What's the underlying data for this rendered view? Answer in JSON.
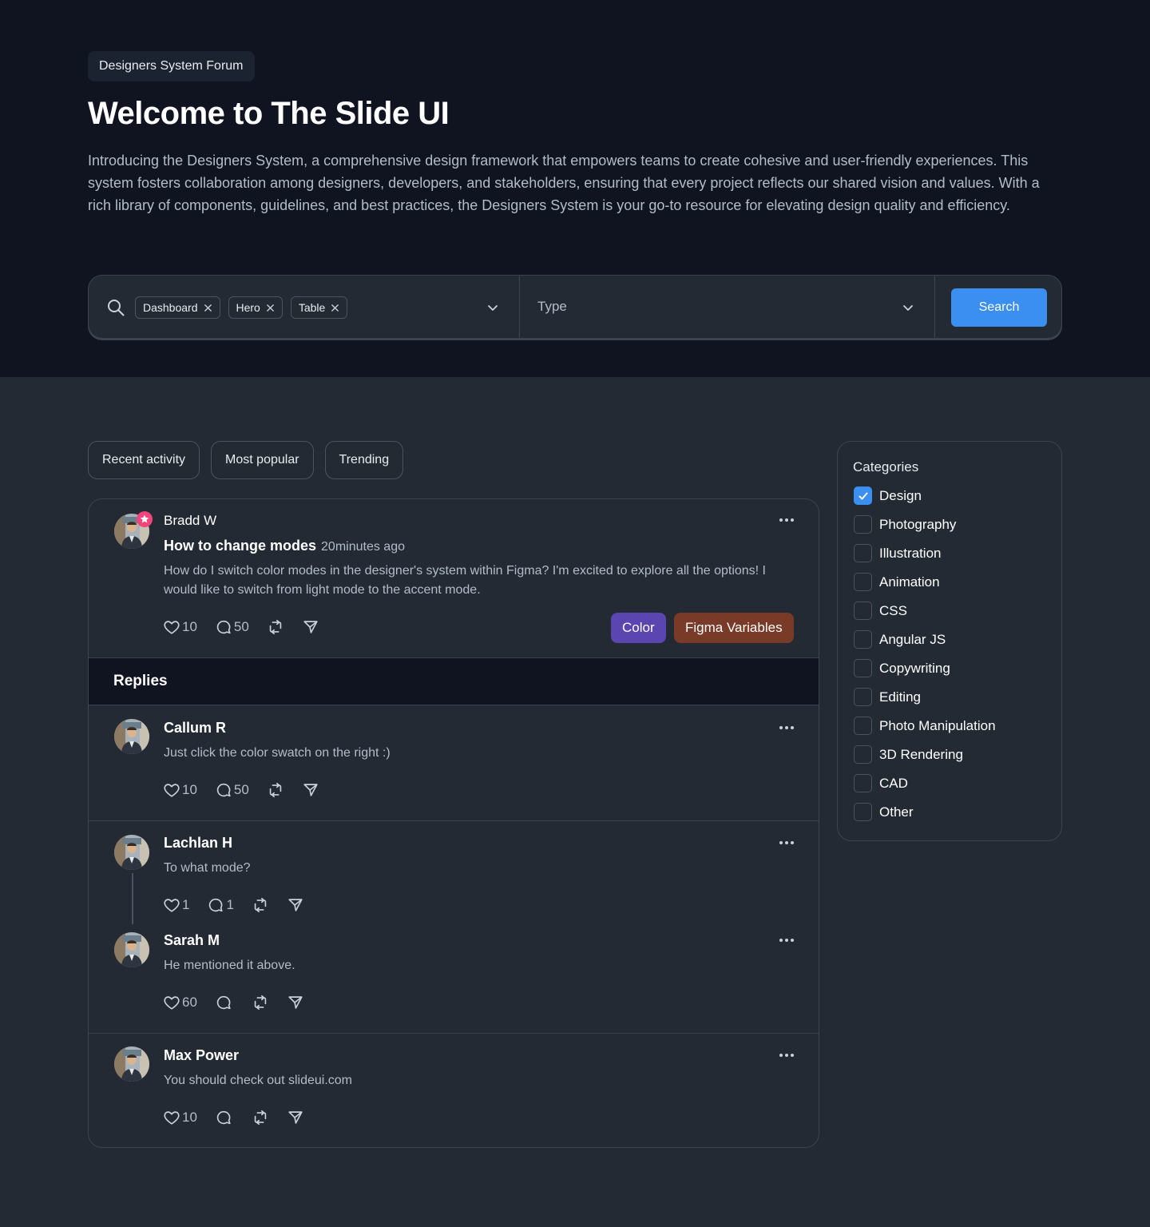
{
  "hero": {
    "badge": "Designers System Forum",
    "title": "Welcome to The Slide UI",
    "description": "Introducing the Designers System, a comprehensive design framework that empowers teams to create cohesive and user-friendly experiences. This system fosters collaboration among designers, developers, and stakeholders, ensuring that every project reflects our shared vision and values. With a rich library of components, guidelines, and best practices, the Designers System is your go-to resource for elevating design quality and efficiency."
  },
  "search": {
    "chips": [
      "Dashboard",
      "Hero",
      "Table"
    ],
    "type_placeholder": "Type",
    "button_label": "Search"
  },
  "tabs": [
    "Recent activity",
    "Most popular",
    "Trending"
  ],
  "post": {
    "author": "Bradd W",
    "title": "How to change modes",
    "time": "20minutes ago",
    "body": "How do I switch color modes in the designer's system within Figma? I'm excited to explore all the options! I would like to switch from light mode to the accent mode.",
    "likes": "10",
    "comments": "50",
    "tags": [
      {
        "label": "Color",
        "color": "#5b45b0"
      },
      {
        "label": "Figma Variables",
        "color": "#7a3a28"
      }
    ]
  },
  "replies_title": "Replies",
  "replies": [
    {
      "author": "Callum R",
      "body": "Just click the color swatch on the right :)",
      "likes": "10",
      "comments": "50"
    },
    {
      "author": "Lachlan H",
      "body": "To what mode?",
      "likes": "1",
      "comments": "1"
    },
    {
      "author": "Sarah M",
      "body": "He mentioned it above.",
      "likes": "60",
      "comments": ""
    },
    {
      "author": "Max Power",
      "body": "You should check out slideui.com",
      "likes": "10",
      "comments": ""
    }
  ],
  "categories": {
    "title": "Categories",
    "items": [
      {
        "label": "Design",
        "checked": true
      },
      {
        "label": "Photography",
        "checked": false
      },
      {
        "label": "Illustration",
        "checked": false
      },
      {
        "label": "Animation",
        "checked": false
      },
      {
        "label": "CSS",
        "checked": false
      },
      {
        "label": "Angular JS",
        "checked": false
      },
      {
        "label": "Copywriting",
        "checked": false
      },
      {
        "label": "Editing",
        "checked": false
      },
      {
        "label": "Photo Manipulation",
        "checked": false
      },
      {
        "label": "3D Rendering",
        "checked": false
      },
      {
        "label": "CAD",
        "checked": false
      },
      {
        "label": "Other",
        "checked": false
      }
    ]
  },
  "colors": {
    "accent": "#3b8ff0",
    "hero_bg": "#0f1420",
    "page_bg": "#232a33",
    "star_badge": "#f0457a"
  }
}
